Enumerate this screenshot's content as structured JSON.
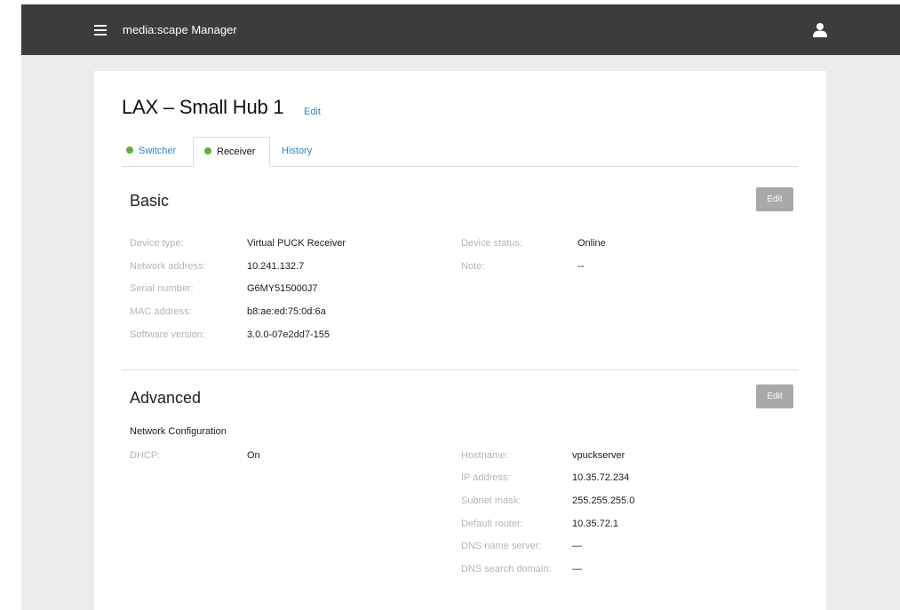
{
  "header": {
    "app_title": "media:scape Manager",
    "menu_icon": "hamburger-menu-icon",
    "user_icon": "user-icon"
  },
  "page": {
    "title": "LAX – Small Hub 1",
    "title_edit": "Edit"
  },
  "tabs": [
    {
      "label": "Switcher",
      "status_dot": true,
      "active": false
    },
    {
      "label": "Receiver",
      "status_dot": true,
      "active": true
    },
    {
      "label": "History",
      "status_dot": false,
      "active": false
    }
  ],
  "colors": {
    "topbar": "#3c3c3c",
    "link": "#2f86c8",
    "status_online": "#5ab535",
    "edit_button": "#a9a9a9"
  },
  "basic": {
    "title": "Basic",
    "edit_label": "Edit",
    "left": [
      {
        "label": "Device type:",
        "value": "Virtual PUCK Receiver"
      },
      {
        "label": "Network address:",
        "value": "10.241.132.7"
      },
      {
        "label": "Serial number:",
        "value": "G6MY515000J7"
      },
      {
        "label": "MAC address:",
        "value": "b8:ae:ed:75:0d:6a"
      },
      {
        "label": "Software version:",
        "value": "3.0.0-07e2dd7-155"
      }
    ],
    "right": [
      {
        "label": "Device status:",
        "value": "Online"
      },
      {
        "label": "Note:",
        "value": "--"
      }
    ]
  },
  "advanced": {
    "title": "Advanced",
    "edit_label": "Edit",
    "subheading": "Network Configuration",
    "left": [
      {
        "label": "DHCP:",
        "value": "On"
      }
    ],
    "right": [
      {
        "label": "Hostname:",
        "value": "vpuckserver"
      },
      {
        "label": "IP address:",
        "value": "10.35.72.234"
      },
      {
        "label": "Subnet mask:",
        "value": "255.255.255.0"
      },
      {
        "label": "Default router:",
        "value": "10.35.72.1"
      },
      {
        "label": "DNS name server:",
        "value": "—"
      },
      {
        "label": "DNS search domain:",
        "value": "—"
      }
    ]
  }
}
